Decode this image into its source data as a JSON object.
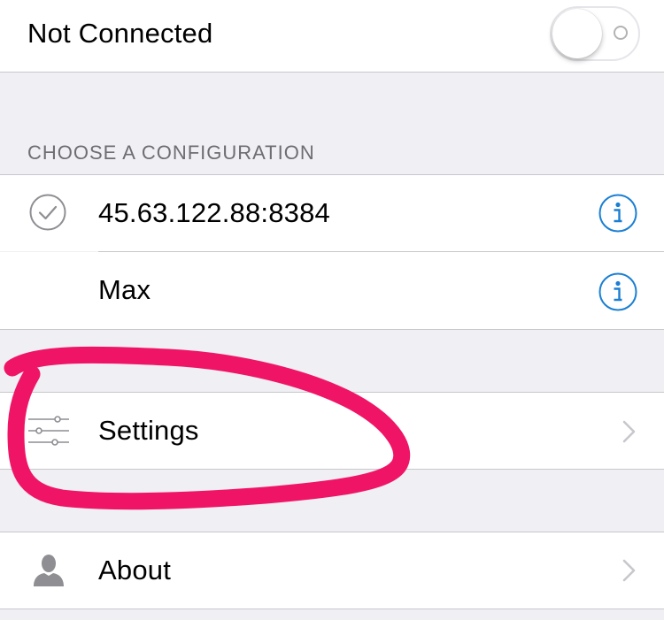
{
  "vpn_toggle": {
    "label": "Not Connected",
    "on": false
  },
  "configurations": {
    "header": "CHOOSE A CONFIGURATION",
    "items": [
      {
        "label": "45.63.122.88:8384",
        "selected": true
      },
      {
        "label": "Max",
        "selected": false
      }
    ]
  },
  "menu": {
    "settings": "Settings",
    "about": "About"
  },
  "colors": {
    "background": "#efeff4",
    "accent": "#1a7fd3",
    "annotation": "#f01467",
    "separator": "#c8c7cc"
  }
}
